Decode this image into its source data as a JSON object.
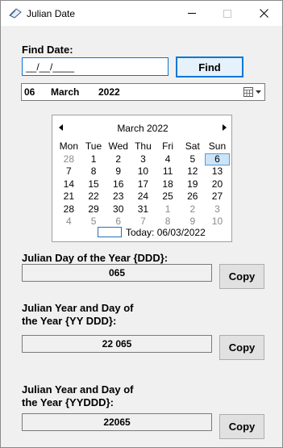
{
  "window": {
    "title": "Julian Date",
    "icons": {
      "app": "calendar-app-icon",
      "minimize": "minimize-icon",
      "maximize": "maximize-icon",
      "close": "close-icon"
    }
  },
  "find": {
    "label": "Find Date:",
    "input_value": "__/__/____",
    "button_label": "Find"
  },
  "date_picker": {
    "day": "06",
    "month": "March",
    "year": "2022",
    "button_icon": "calendar-dropdown-icon"
  },
  "calendar": {
    "title": "March 2022",
    "weekdays": [
      "Mon",
      "Tue",
      "Wed",
      "Thu",
      "Fri",
      "Sat",
      "Sun"
    ],
    "weeks": [
      [
        {
          "d": "28",
          "dim": true
        },
        {
          "d": "1"
        },
        {
          "d": "2"
        },
        {
          "d": "3"
        },
        {
          "d": "4"
        },
        {
          "d": "5"
        },
        {
          "d": "6",
          "sel": true
        }
      ],
      [
        {
          "d": "7"
        },
        {
          "d": "8"
        },
        {
          "d": "9"
        },
        {
          "d": "10"
        },
        {
          "d": "11"
        },
        {
          "d": "12"
        },
        {
          "d": "13"
        }
      ],
      [
        {
          "d": "14"
        },
        {
          "d": "15"
        },
        {
          "d": "16"
        },
        {
          "d": "17"
        },
        {
          "d": "18"
        },
        {
          "d": "19"
        },
        {
          "d": "20"
        }
      ],
      [
        {
          "d": "21"
        },
        {
          "d": "22"
        },
        {
          "d": "23"
        },
        {
          "d": "24"
        },
        {
          "d": "25"
        },
        {
          "d": "26"
        },
        {
          "d": "27"
        }
      ],
      [
        {
          "d": "28"
        },
        {
          "d": "29"
        },
        {
          "d": "30"
        },
        {
          "d": "31"
        },
        {
          "d": "1",
          "dim": true
        },
        {
          "d": "2",
          "dim": true
        },
        {
          "d": "3",
          "dim": true
        }
      ],
      [
        {
          "d": "4",
          "dim": true
        },
        {
          "d": "5",
          "dim": true
        },
        {
          "d": "6",
          "dim": true
        },
        {
          "d": "7",
          "dim": true
        },
        {
          "d": "8",
          "dim": true
        },
        {
          "d": "9",
          "dim": true
        },
        {
          "d": "10",
          "dim": true
        }
      ]
    ],
    "today_label": "Today: 06/03/2022"
  },
  "results": {
    "ddd": {
      "label": "Julian Day of the Year {DDD}:",
      "value": "065",
      "copy_label": "Copy"
    },
    "yy_ddd": {
      "label_line1": "Julian Year and Day of",
      "label_line2": "the Year {YY DDD}:",
      "value": "22 065",
      "copy_label": "Copy"
    },
    "yyddd": {
      "label_line1": "Julian Year and Day of",
      "label_line2": "the Year {YYDDD}:",
      "value": "22065",
      "copy_label": "Copy"
    }
  },
  "colors": {
    "accent": "#0078d7",
    "selected_day_bg": "#cce4f7",
    "dim_text": "#8a8a8a"
  }
}
